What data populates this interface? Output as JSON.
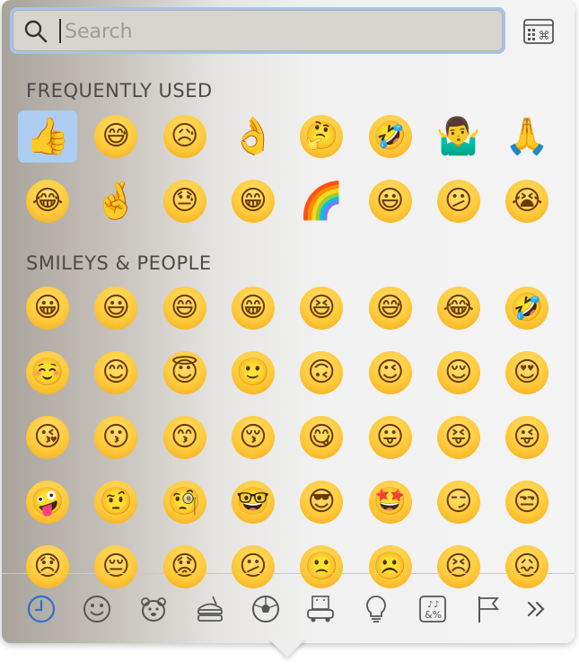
{
  "search": {
    "placeholder": "Search",
    "value": ""
  },
  "sections": {
    "frequently_used": {
      "title": "FREQUENTLY USED",
      "items": [
        {
          "glyph": "👍",
          "name": "thumbs-up",
          "face": false,
          "selected": true
        },
        {
          "glyph": "😅",
          "name": "grinning-sweat",
          "face": true
        },
        {
          "glyph": "😥",
          "name": "sad-relieved",
          "face": true
        },
        {
          "glyph": "👌",
          "name": "ok-hand",
          "face": false
        },
        {
          "glyph": "🤔",
          "name": "thinking",
          "face": true
        },
        {
          "glyph": "🤣",
          "name": "rolling-laughing",
          "face": true
        },
        {
          "glyph": "🤷‍♂️",
          "name": "man-shrugging",
          "face": false
        },
        {
          "glyph": "🙏",
          "name": "folded-hands",
          "face": false
        },
        {
          "glyph": "😂",
          "name": "tears-of-joy",
          "face": true
        },
        {
          "glyph": "🤞",
          "name": "crossed-fingers",
          "face": false
        },
        {
          "glyph": "😓",
          "name": "downcast-sweat",
          "face": true
        },
        {
          "glyph": "😁",
          "name": "beaming",
          "face": true
        },
        {
          "glyph": "🌈",
          "name": "rainbow",
          "face": false
        },
        {
          "glyph": "😃",
          "name": "grinning-big-eyes",
          "face": true
        },
        {
          "glyph": "😕",
          "name": "confused",
          "face": true
        },
        {
          "glyph": "😭",
          "name": "loudly-crying",
          "face": true
        }
      ]
    },
    "smileys_people": {
      "title": "SMILEYS & PEOPLE",
      "items": [
        {
          "glyph": "😀",
          "name": "grinning",
          "face": true
        },
        {
          "glyph": "😃",
          "name": "grinning-big-eyes",
          "face": true
        },
        {
          "glyph": "😄",
          "name": "grinning-smiling-eyes",
          "face": true
        },
        {
          "glyph": "😁",
          "name": "beaming",
          "face": true
        },
        {
          "glyph": "😆",
          "name": "squinting-laughing",
          "face": true
        },
        {
          "glyph": "😅",
          "name": "grinning-sweat",
          "face": true
        },
        {
          "glyph": "😂",
          "name": "tears-of-joy",
          "face": true
        },
        {
          "glyph": "🤣",
          "name": "rolling-laughing",
          "face": true
        },
        {
          "glyph": "☺️",
          "name": "smiling",
          "face": true
        },
        {
          "glyph": "😊",
          "name": "smiling-eyes",
          "face": true
        },
        {
          "glyph": "😇",
          "name": "halo",
          "face": true
        },
        {
          "glyph": "🙂",
          "name": "slightly-smiling",
          "face": true
        },
        {
          "glyph": "🙃",
          "name": "upside-down",
          "face": true
        },
        {
          "glyph": "😉",
          "name": "winking",
          "face": true
        },
        {
          "glyph": "😌",
          "name": "relieved",
          "face": true
        },
        {
          "glyph": "😍",
          "name": "heart-eyes",
          "face": true
        },
        {
          "glyph": "😘",
          "name": "blowing-kiss",
          "face": true
        },
        {
          "glyph": "😗",
          "name": "kissing",
          "face": true
        },
        {
          "glyph": "😙",
          "name": "kissing-smiling-eyes",
          "face": true
        },
        {
          "glyph": "😚",
          "name": "kissing-closed-eyes",
          "face": true
        },
        {
          "glyph": "😋",
          "name": "savoring-food",
          "face": true
        },
        {
          "glyph": "😛",
          "name": "tongue",
          "face": true
        },
        {
          "glyph": "😝",
          "name": "squinting-tongue",
          "face": true
        },
        {
          "glyph": "😜",
          "name": "winking-tongue",
          "face": true
        },
        {
          "glyph": "🤪",
          "name": "zany",
          "face": true
        },
        {
          "glyph": "🤨",
          "name": "raised-eyebrow",
          "face": true
        },
        {
          "glyph": "🧐",
          "name": "monocle",
          "face": true
        },
        {
          "glyph": "🤓",
          "name": "nerd",
          "face": true
        },
        {
          "glyph": "😎",
          "name": "sunglasses",
          "face": true
        },
        {
          "glyph": "🤩",
          "name": "star-struck",
          "face": true
        },
        {
          "glyph": "😏",
          "name": "smirking",
          "face": true
        },
        {
          "glyph": "😒",
          "name": "unamused",
          "face": true
        },
        {
          "glyph": "😞",
          "name": "disappointed",
          "face": true
        },
        {
          "glyph": "😔",
          "name": "pensive",
          "face": true
        },
        {
          "glyph": "😟",
          "name": "worried",
          "face": true
        },
        {
          "glyph": "😕",
          "name": "confused",
          "face": true
        },
        {
          "glyph": "🙁",
          "name": "slightly-frowning",
          "face": true
        },
        {
          "glyph": "☹️",
          "name": "frowning",
          "face": true
        },
        {
          "glyph": "😣",
          "name": "persevering",
          "face": true
        },
        {
          "glyph": "😖",
          "name": "confounded",
          "face": true
        }
      ]
    }
  },
  "categories": [
    {
      "name": "recent",
      "active": true
    },
    {
      "name": "smileys"
    },
    {
      "name": "animals"
    },
    {
      "name": "food"
    },
    {
      "name": "activity"
    },
    {
      "name": "travel"
    },
    {
      "name": "objects"
    },
    {
      "name": "symbols"
    },
    {
      "name": "flags"
    },
    {
      "name": "more"
    }
  ],
  "colors": {
    "accent": "#2f6fd0",
    "selected_bg": "#aecdf3",
    "search_ring": "#a6c3ec"
  }
}
